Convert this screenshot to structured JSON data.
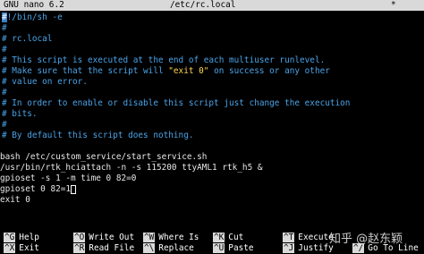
{
  "titlebar": {
    "app": "GNU nano 6.2",
    "file": "/etc/rc.local",
    "modified": "*"
  },
  "editor": {
    "lines": [
      {
        "text": "!/bin/sh -e",
        "type": "comment_hl"
      },
      {
        "text": "#",
        "type": "comment"
      },
      {
        "text": "# rc.local",
        "type": "comment"
      },
      {
        "text": "#",
        "type": "comment"
      },
      {
        "text": "# This script is executed at the end of each multiuser runlevel.",
        "type": "comment"
      },
      {
        "text": "# Make sure that the script will \"exit 0\" on success or any other",
        "type": "comment_str"
      },
      {
        "text": "# value on error.",
        "type": "comment"
      },
      {
        "text": "#",
        "type": "comment"
      },
      {
        "text": "# In order to enable or disable this script just change the execution",
        "type": "comment"
      },
      {
        "text": "# bits.",
        "type": "comment"
      },
      {
        "text": "#",
        "type": "comment"
      },
      {
        "text": "# By default this script does nothing.",
        "type": "comment"
      },
      {
        "text": "",
        "type": "blank"
      },
      {
        "text": "bash /etc/custom_service/start_service.sh",
        "type": "code"
      },
      {
        "text": "/usr/bin/rtk_hciattach -n -s 115200 ttyAML1 rtk_h5 &",
        "type": "code"
      },
      {
        "text": "gpioset -s 1 -m time 0 82=0",
        "type": "code"
      },
      {
        "text": "gpioset 0 82=1",
        "type": "code_cursor"
      },
      {
        "text": "exit 0",
        "type": "code"
      }
    ],
    "str_segment": "\"exit 0\"",
    "hl_char": "#"
  },
  "shortcuts_row1": [
    {
      "key": "^G",
      "label": "Help"
    },
    {
      "key": "^O",
      "label": "Write Out"
    },
    {
      "key": "^W",
      "label": "Where Is"
    },
    {
      "key": "^K",
      "label": "Cut"
    },
    {
      "key": "^T",
      "label": "Execute"
    }
  ],
  "shortcuts_row2": [
    {
      "key": "^X",
      "label": "Exit"
    },
    {
      "key": "^R",
      "label": "Read File"
    },
    {
      "key": "^\\",
      "label": "Replace"
    },
    {
      "key": "^U",
      "label": "Paste"
    },
    {
      "key": "^J",
      "label": "Justify"
    },
    {
      "key": "^/",
      "label": "Go To Line"
    }
  ],
  "watermark": "知乎 @赵东颖",
  "colors": {
    "comment": "#4aa3e8",
    "titlebar_bg": "#d9d9d9",
    "string": "#ffd84a",
    "background": "#000000"
  }
}
